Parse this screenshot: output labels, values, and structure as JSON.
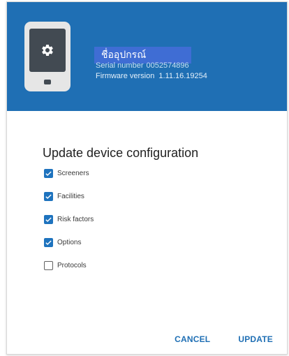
{
  "device": {
    "icon": "gear-icon",
    "name_partial": "6",
    "name_input_value": "ชื่ออุปกรณ์",
    "serial_label": "Serial number",
    "serial_value": "0052574896",
    "firmware_label": "Firmware version",
    "firmware_value": "1.11.16.19254"
  },
  "dialog": {
    "title": "Update device configuration",
    "options": [
      {
        "label": "Screeners",
        "checked": true
      },
      {
        "label": "Facilities",
        "checked": true
      },
      {
        "label": "Risk factors",
        "checked": true
      },
      {
        "label": "Options",
        "checked": true
      },
      {
        "label": "Protocols",
        "checked": false
      }
    ],
    "cancel_label": "CANCEL",
    "update_label": "UPDATE"
  },
  "colors": {
    "header": "#1f6fb4",
    "input_highlight": "#3f6dd4",
    "accent": "#1e73be"
  }
}
